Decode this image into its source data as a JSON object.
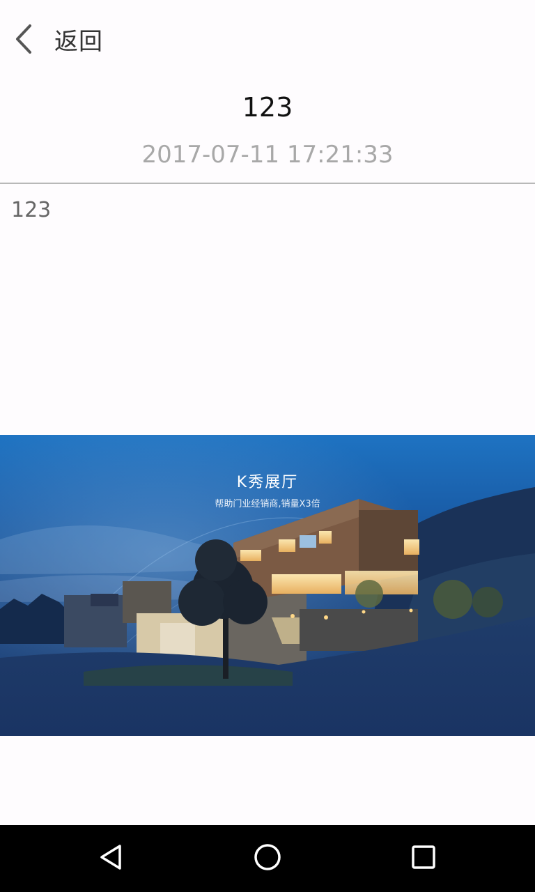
{
  "header": {
    "back_label": "返回",
    "back_icon": "chevron-left-icon"
  },
  "article": {
    "title": "123",
    "timestamp": "2017-07-11 17:21:33",
    "body": "123"
  },
  "banner": {
    "title": "K秀展厅",
    "subtitle": "帮助门业经销商,销量X3倍"
  },
  "navbar": {
    "back_icon": "triangle-back-icon",
    "home_icon": "circle-home-icon",
    "recents_icon": "square-recents-icon"
  },
  "colors": {
    "background": "#fefcfe",
    "timestamp": "#a8a8a8",
    "banner_blue": "#1e73c2",
    "navbar": "#000000"
  }
}
